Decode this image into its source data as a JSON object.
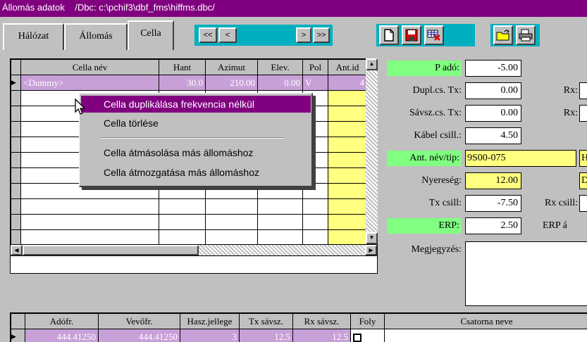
{
  "window": {
    "title": "Állomás adatok    /Dbc: c:\\pchif3\\dbf_fms\\hiffms.dbc/"
  },
  "tabs": [
    {
      "label": "Hálózat"
    },
    {
      "label": "Állomás"
    },
    {
      "label": "Cella"
    }
  ],
  "nav": {
    "first": "<<",
    "prev": "<",
    "next": ">",
    "last": ">>"
  },
  "toolbar_icons": [
    "new-document-icon",
    "save-icon",
    "delete-record-icon",
    "open-folder-icon",
    "print-icon"
  ],
  "cell_table": {
    "headers": [
      "Cella név",
      "Hant",
      "Azimut",
      "Elev.",
      "Pol",
      "Ant.id"
    ],
    "rows": [
      {
        "name": "<Dummy>",
        "hant": "30.0",
        "azimut": "210.00",
        "elev": "0.00",
        "pol": "V",
        "ant_id": "4"
      }
    ]
  },
  "params": {
    "p_ado": {
      "label": "P adó:",
      "value": "-5.00"
    },
    "dupl_tx": {
      "label": "Dupl.cs. Tx:",
      "value": "0.00"
    },
    "savsz_tx": {
      "label": "Sávsz.cs. Tx:",
      "value": "0.00"
    },
    "kabel": {
      "label": "Kábel csill.:",
      "value": "4.50"
    },
    "ant_nev": {
      "label": "Ant. név/tip:",
      "value": "9S00-075"
    },
    "nyereseg": {
      "label": "Nyereség:",
      "value": "12.00"
    },
    "tx_csill": {
      "label": "Tx csill:",
      "value": "-7.50"
    },
    "erp": {
      "label": "ERP:",
      "value": "2.50"
    },
    "rx1": {
      "label": "Rx:"
    },
    "rx2": {
      "label": "Rx:"
    },
    "rx_csill": {
      "label": "Rx csill:"
    },
    "erp_a": {
      "label": "ERP á"
    },
    "side_h": "H",
    "side_d": "D",
    "megjegyzes": {
      "label": "Megjegyzés:",
      "value": ""
    }
  },
  "context_menu": {
    "items": [
      {
        "label": "Cella duplikálása frekvencia nélkül",
        "highlighted": true
      },
      {
        "label": "Cella törlése"
      },
      {
        "label": "Cella átmásolása más állomáshoz"
      },
      {
        "label": "Cella átmozgatása más állomáshoz"
      }
    ]
  },
  "freq_table": {
    "headers": [
      "Adófr.",
      "Vevőfr.",
      "Hasz.jellege",
      "Tx sávsz.",
      "Rx sávsz.",
      "Foly",
      "Csatorna neve"
    ],
    "rows": [
      {
        "adofr": "444.41250",
        "vevofr": "444.41250",
        "hasz": "3",
        "tx": "12.5",
        "rx": "12.5",
        "foly": "",
        "csatorna": ""
      }
    ]
  }
}
